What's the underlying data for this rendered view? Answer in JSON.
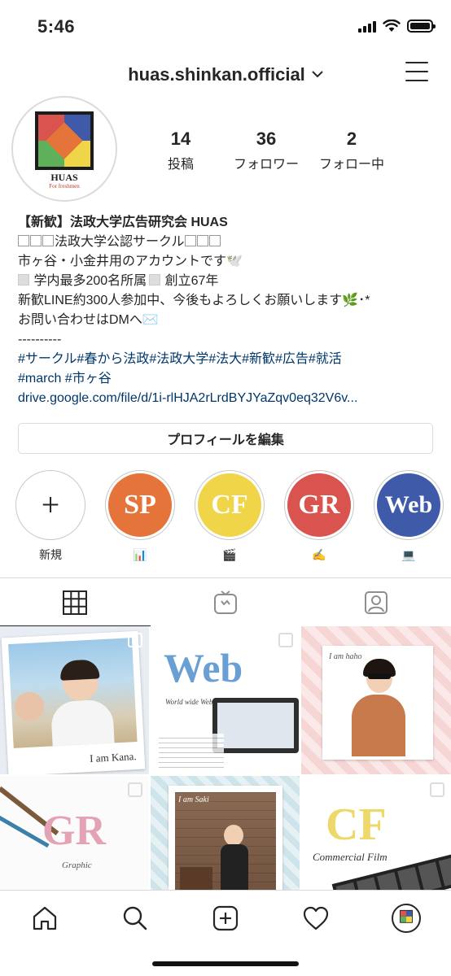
{
  "status_bar": {
    "time": "5:46"
  },
  "header": {
    "username": "huas.shinkan.official"
  },
  "avatar": {
    "logo_text": "HUAS",
    "logo_sub": "For freshmen"
  },
  "stats": [
    {
      "value": "14",
      "label": "投稿"
    },
    {
      "value": "36",
      "label": "フォロワー"
    },
    {
      "value": "2",
      "label": "フォロー中"
    }
  ],
  "bio": {
    "name": "【新歓】法政大学広告研究会 HUAS",
    "line1": "法政大学公認サークル",
    "line2": "市ヶ谷・小金井用のアカウントです🕊️",
    "line3a": "学内最多200名所属",
    "line3b": "創立67年",
    "line4": "新歓LINE約300人参加中、今後もよろしくお願いします🌿･*",
    "line5": "お問い合わせはDMへ✉️",
    "line6": "----------",
    "hashtags1": "#サークル#春から法政#法政大学#法大#新歓#広告#就活",
    "hashtags2": "#march #市ヶ谷",
    "link": "drive.google.com/file/d/1i-rlHJA2rLrdBYJYaZqv0eq32V6v..."
  },
  "edit_button": "プロフィールを編集",
  "highlights": [
    {
      "text": "+",
      "label": "新規",
      "color": "#ffffff"
    },
    {
      "text": "SP",
      "label": "📊",
      "color": "#e4743a"
    },
    {
      "text": "CF",
      "label": "🎬",
      "color": "#f0d548"
    },
    {
      "text": "GR",
      "label": "✍️",
      "color": "#d9534f"
    },
    {
      "text": "Web",
      "label": "💻",
      "color": "#3f5aa8"
    }
  ],
  "posts": {
    "p1_caption": "I am Kana.",
    "p2_title": "Web",
    "p2_sub": "World wide Web",
    "p3_caption": "I am haho",
    "p4_title": "GR",
    "p4_sub": "Graphic",
    "p5_caption": "I am Saki",
    "p6_title": "CF",
    "p6_sub": "Commercial Film"
  },
  "colors": {
    "link": "#00376b",
    "border": "#dbdbdb",
    "text": "#262626"
  }
}
